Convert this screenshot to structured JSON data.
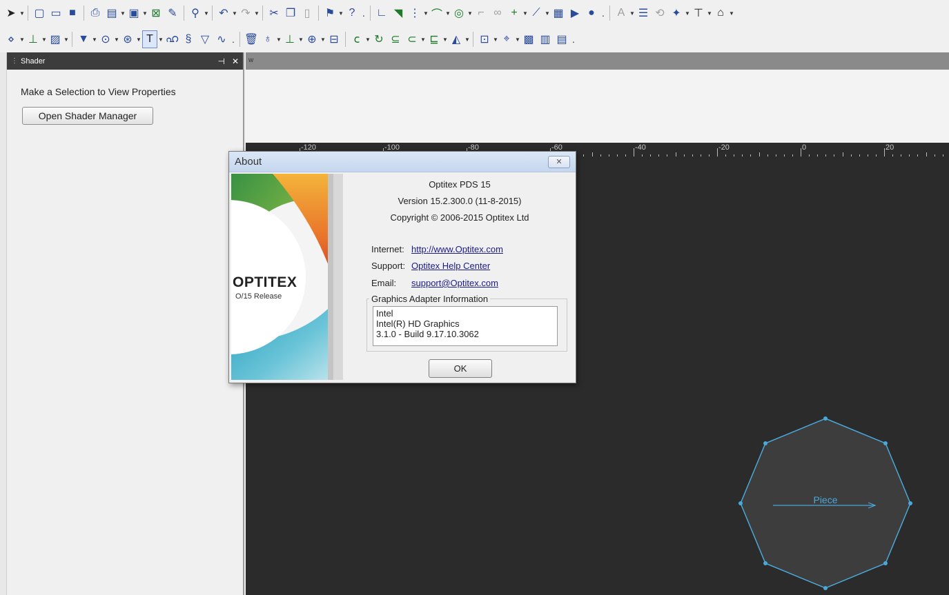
{
  "shader_panel": {
    "title": "Shader",
    "pin": "⊣",
    "close": "✕",
    "message": "Make a Selection to View Properties",
    "open_button": "Open Shader Manager"
  },
  "document": {
    "tab_mark": "w",
    "ruler_labels": [
      "-120",
      "-100",
      "-80",
      "-60",
      "-40",
      "-20",
      "0",
      "20"
    ]
  },
  "about": {
    "title": "About",
    "close": "✕",
    "brand": "OPTITEX",
    "release": "O/15 Release",
    "product": "Optitex PDS 15",
    "version": "Version 15.2.300.0 (11-8-2015)",
    "copyright": "Copyright © 2006-2015 Optitex Ltd",
    "internet_label": "Internet:",
    "internet_link": "http://www.Optitex.com",
    "support_label": "Support:",
    "support_link": "Optitex Help Center",
    "email_label": "Email:",
    "email_link": "support@Optitex.com",
    "gfx_legend": "Graphics Adapter Information",
    "gfx_lines": [
      "Intel",
      "Intel(R) HD Graphics",
      "3.1.0 - Build 9.17.10.3062"
    ],
    "ok": "OK"
  },
  "piece": {
    "label": "Piece",
    "stroke_color": "#4aa8d8"
  }
}
